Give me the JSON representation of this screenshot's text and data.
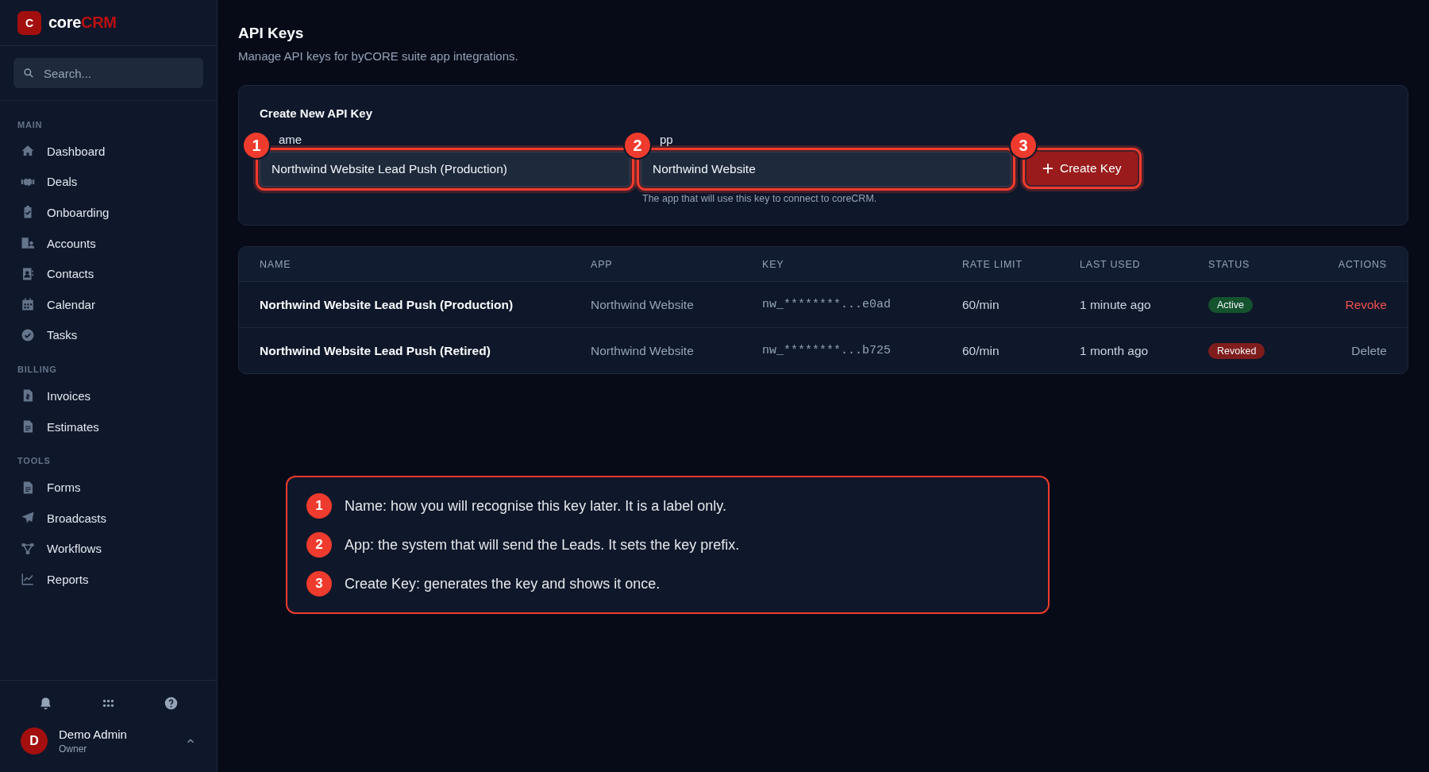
{
  "sidebar": {
    "logo": {
      "letter": "C",
      "name_part1": "core",
      "name_part2": "CRM"
    },
    "search": {
      "placeholder": "Search..."
    },
    "sections": [
      {
        "title": "MAIN",
        "items": [
          {
            "label": "Dashboard",
            "selected": false
          },
          {
            "label": "Deals",
            "selected": false
          },
          {
            "label": "Onboarding",
            "selected": false
          },
          {
            "label": "Accounts",
            "selected": false
          },
          {
            "label": "Contacts",
            "selected": false
          },
          {
            "label": "Calendar",
            "selected": false
          },
          {
            "label": "Tasks",
            "selected": false
          }
        ]
      },
      {
        "title": "BILLING",
        "items": [
          {
            "label": "Invoices",
            "selected": false
          },
          {
            "label": "Estimates",
            "selected": false
          }
        ]
      },
      {
        "title": "TOOLS",
        "items": [
          {
            "label": "Forms",
            "selected": false
          },
          {
            "label": "Broadcasts",
            "selected": false
          },
          {
            "label": "Workflows",
            "selected": false
          },
          {
            "label": "Reports",
            "selected": false
          }
        ]
      }
    ],
    "user": {
      "initial": "D",
      "name": "Demo Admin",
      "role": "Owner"
    }
  },
  "page": {
    "title": "API Keys",
    "subtitle": "Manage API keys for byCORE suite app integrations."
  },
  "create_form": {
    "title": "Create New API Key",
    "fields": [
      {
        "label": "ame",
        "value": "Northwind Website Lead Push (Production)",
        "marker": "1"
      },
      {
        "label": "pp",
        "value": "Northwind Website",
        "hint": "The app that will use this key to connect to coreCRM.",
        "marker": "2"
      }
    ],
    "button": {
      "label": "Create Key",
      "marker": "3"
    }
  },
  "table": {
    "columns": [
      "NAME",
      "APP",
      "KEY",
      "RATE LIMIT",
      "LAST USED",
      "STATUS",
      "ACTIONS"
    ],
    "rows": [
      {
        "name": "Northwind Website Lead Push (Production)",
        "app": "Northwind Website",
        "key": "nw_********...e0ad",
        "rate_limit": "60/min",
        "last_used": "1 minute ago",
        "status": {
          "label": "Active",
          "color": "#14532d"
        },
        "action": {
          "label": "Revoke",
          "color": "#f05252"
        }
      },
      {
        "name": "Northwind Website Lead Push (Retired)",
        "app": "Northwind Website",
        "key": "nw_********...b725",
        "rate_limit": "60/min",
        "last_used": "1 month ago",
        "status": {
          "label": "Revoked",
          "color": "#7f1d1d"
        },
        "action": {
          "label": "Delete",
          "color": "#94a3b8"
        }
      }
    ]
  },
  "callout": {
    "items": [
      {
        "marker": "1",
        "text": "Name: how you will recognise this key later. It is a label only."
      },
      {
        "marker": "2",
        "text": "App: the system that will send the Leads. It sets the key prefix."
      },
      {
        "marker": "3",
        "text": "Create Key: generates the key and shows it once."
      }
    ]
  }
}
